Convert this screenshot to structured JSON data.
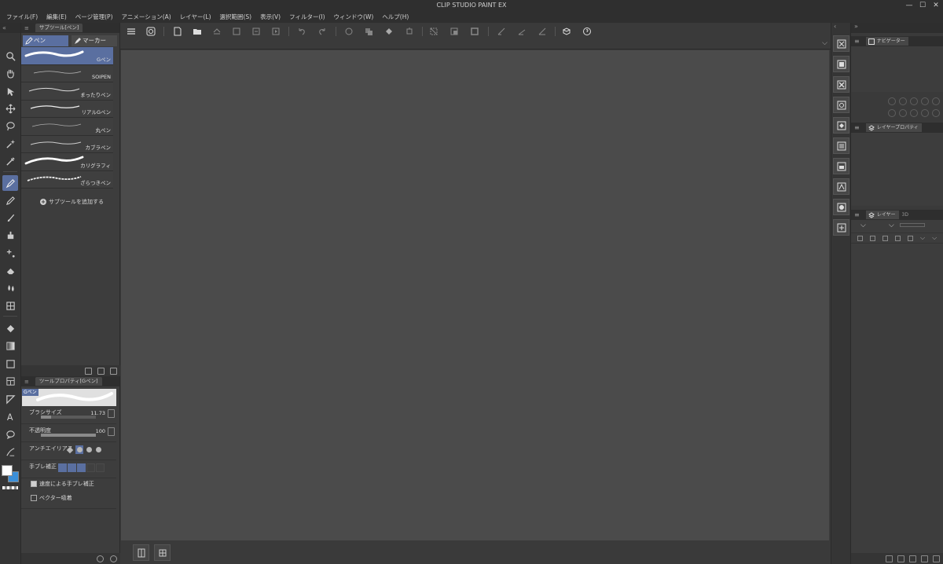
{
  "window": {
    "title": "CLIP STUDIO PAINT EX",
    "minimize": "—",
    "maximize": "☐",
    "close": "✕"
  },
  "menu": [
    "ファイル(F)",
    "編集(E)",
    "ページ管理(P)",
    "アニメーション(A)",
    "レイヤー(L)",
    "選択範囲(S)",
    "表示(V)",
    "フィルター(I)",
    "ウィンドウ(W)",
    "ヘルプ(H)"
  ],
  "subtool": {
    "header_tab": "サブツール[ペン]",
    "groups": [
      {
        "label": "ペン",
        "selected": true
      },
      {
        "label": "マーカー",
        "selected": false
      }
    ],
    "brushes": [
      "Gペン",
      "SOIPEN",
      "まったりペン",
      "リアルGペン",
      "丸ペン",
      "カブラペン",
      "カリグラフィ",
      "ざらつきペン"
    ],
    "add_label": "サブツールを追加する"
  },
  "toolprop": {
    "header_tab": "ツールプロパティ[Gペン]",
    "preview_tag": "Gペン",
    "brush_size_label": "ブラシサイズ",
    "brush_size_value": "11.73",
    "brush_size_fraction": 0.18,
    "opacity_label": "不透明度",
    "opacity_value": "100",
    "opacity_fraction": 1.0,
    "antialias_label": "アンチエイリアス",
    "stabilization_label": "手ブレ補正",
    "speed_label": "速度による手ブレ補正",
    "vector_label": "ベクター吸着"
  },
  "navigator": {
    "tab": "ナビゲーター"
  },
  "layerprop": {
    "tab": "レイヤープロパティ"
  },
  "layer": {
    "tab": "レイヤー",
    "tab2": "3D"
  },
  "colors": {
    "accent": "#5a6fa0",
    "canvas": "#4b4b4b",
    "main_color": "#ffffff",
    "sub_color": "#3b8fd8"
  }
}
